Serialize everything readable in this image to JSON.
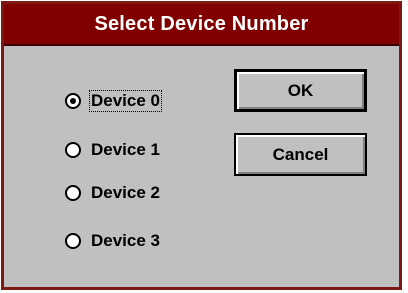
{
  "dialog": {
    "title": "Select Device Number",
    "options": [
      {
        "label": "Device 0",
        "selected": true
      },
      {
        "label": "Device 1",
        "selected": false
      },
      {
        "label": "Device 2",
        "selected": false
      },
      {
        "label": "Device 3",
        "selected": false
      }
    ],
    "ok_label": "OK",
    "cancel_label": "Cancel"
  },
  "colors": {
    "title_bar": "#800000",
    "title_text": "#ffffff",
    "dialog_face": "#c0c0c0",
    "frame": "#7a1a12"
  }
}
